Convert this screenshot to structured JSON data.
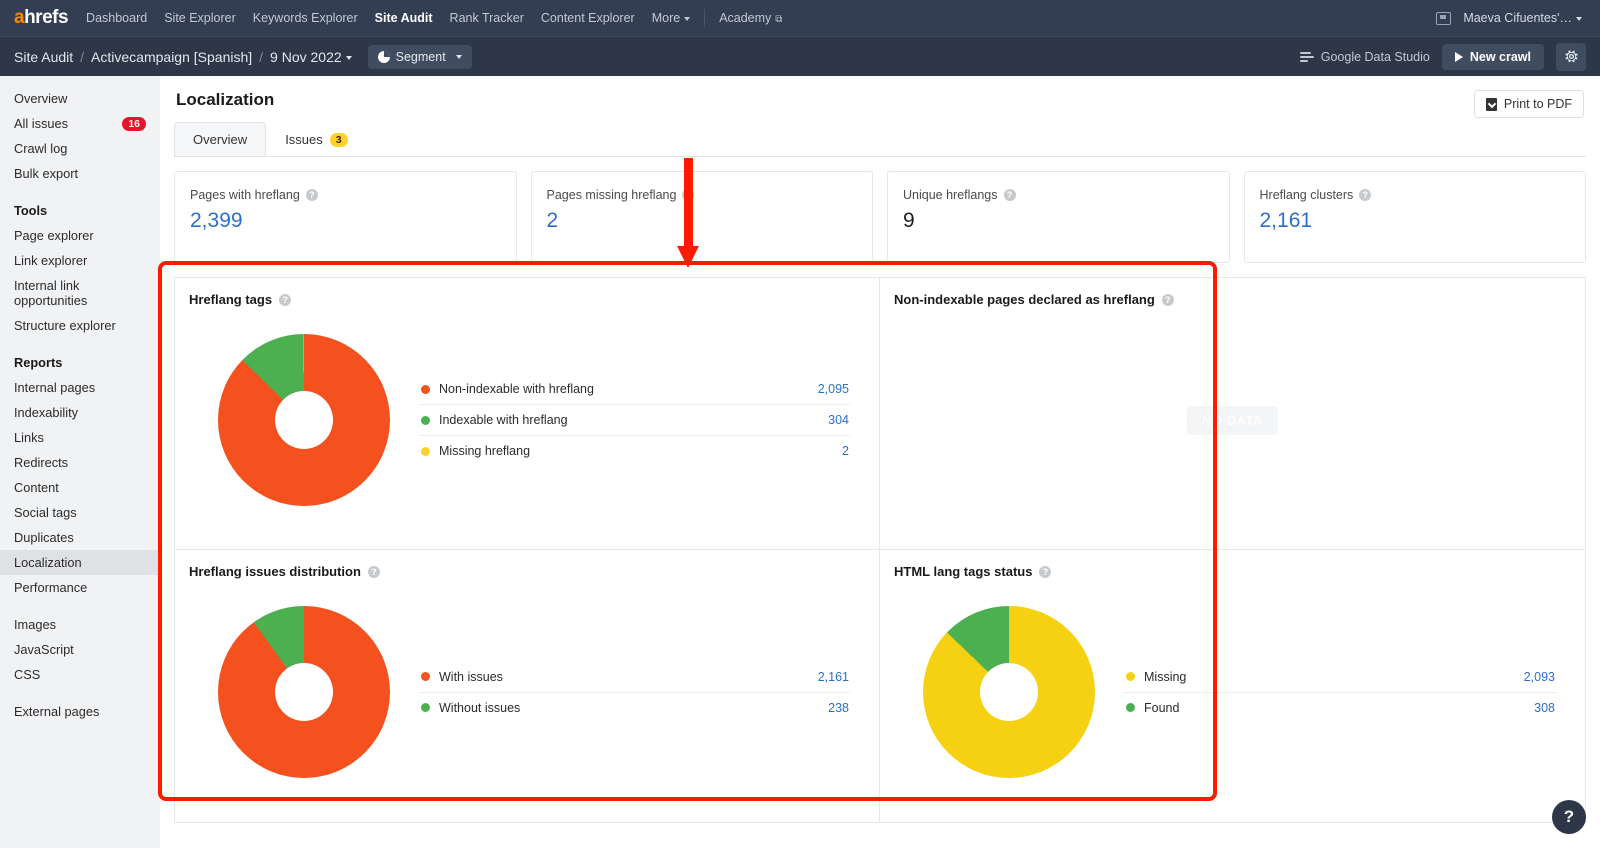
{
  "topnav": {
    "logo": "ahrefs",
    "links": [
      {
        "label": "Dashboard",
        "active": false
      },
      {
        "label": "Site Explorer",
        "active": false
      },
      {
        "label": "Keywords Explorer",
        "active": false
      },
      {
        "label": "Site Audit",
        "active": true
      },
      {
        "label": "Rank Tracker",
        "active": false
      },
      {
        "label": "Content Explorer",
        "active": false
      },
      {
        "label": "More",
        "active": false,
        "caret": true
      }
    ],
    "academy": "Academy",
    "user": "Maeva Cifuentes'…"
  },
  "breadcrumb": {
    "root": "Site Audit",
    "project": "Activecampaign [Spanish]",
    "date": "9 Nov 2022",
    "segment": "Segment",
    "google_data_studio": "Google Data Studio",
    "new_crawl": "New crawl"
  },
  "sidebar": {
    "items": [
      {
        "label": "Overview",
        "type": "item"
      },
      {
        "label": "All issues",
        "type": "item",
        "badge": "16"
      },
      {
        "label": "Crawl log",
        "type": "item"
      },
      {
        "label": "Bulk export",
        "type": "item"
      },
      {
        "label": "Tools",
        "type": "head"
      },
      {
        "label": "Page explorer",
        "type": "item"
      },
      {
        "label": "Link explorer",
        "type": "item"
      },
      {
        "label": "Internal link opportunities",
        "type": "item"
      },
      {
        "label": "Structure explorer",
        "type": "item"
      },
      {
        "label": "Reports",
        "type": "head"
      },
      {
        "label": "Internal pages",
        "type": "item"
      },
      {
        "label": "Indexability",
        "type": "item"
      },
      {
        "label": "Links",
        "type": "item"
      },
      {
        "label": "Redirects",
        "type": "item"
      },
      {
        "label": "Content",
        "type": "item"
      },
      {
        "label": "Social tags",
        "type": "item"
      },
      {
        "label": "Duplicates",
        "type": "item"
      },
      {
        "label": "Localization",
        "type": "item",
        "selected": true
      },
      {
        "label": "Performance",
        "type": "item"
      },
      {
        "label": "",
        "type": "gap"
      },
      {
        "label": "Images",
        "type": "item"
      },
      {
        "label": "JavaScript",
        "type": "item"
      },
      {
        "label": "CSS",
        "type": "item"
      },
      {
        "label": "",
        "type": "gap"
      },
      {
        "label": "External pages",
        "type": "item"
      }
    ]
  },
  "main": {
    "page_title": "Localization",
    "print_to_pdf": "Print to PDF",
    "tabs": [
      {
        "label": "Overview",
        "active": true
      },
      {
        "label": "Issues",
        "active": false,
        "badge": "3"
      }
    ],
    "cards": [
      {
        "label": "Pages with hreflang",
        "value": "2,399",
        "dark": false
      },
      {
        "label": "Pages missing hreflang",
        "value": "2",
        "dark": false
      },
      {
        "label": "Unique hreflangs",
        "value": "9",
        "dark": true
      },
      {
        "label": "Hreflang clusters",
        "value": "2,161",
        "dark": false
      }
    ],
    "help": "?"
  },
  "chart_data": [
    {
      "type": "pie",
      "title": "Hreflang tags",
      "labels": [
        "Non-indexable with hreflang",
        "Indexable with hreflang",
        "Missing hreflang"
      ],
      "values": [
        2095,
        304,
        2
      ],
      "value_labels": [
        "2,095",
        "304",
        "2"
      ],
      "colors": [
        "#f4511e",
        "#4caf50",
        "#ffd028"
      ],
      "legend": "right",
      "donut": true
    },
    {
      "type": "pie",
      "title": "Non-indexable pages declared as hreflang",
      "labels": [],
      "values": [],
      "value_labels": [],
      "colors": [],
      "empty_text": "NO DATA",
      "donut": true
    },
    {
      "type": "pie",
      "title": "Hreflang issues distribution",
      "labels": [
        "With issues",
        "Without issues"
      ],
      "values": [
        2161,
        238
      ],
      "value_labels": [
        "2,161",
        "238"
      ],
      "colors": [
        "#f4511e",
        "#4caf50"
      ],
      "legend": "right",
      "donut": true
    },
    {
      "type": "pie",
      "title": "HTML lang tags status",
      "labels": [
        "Missing",
        "Found"
      ],
      "values": [
        2093,
        308
      ],
      "value_labels": [
        "2,093",
        "308"
      ],
      "colors": [
        "#f5d112",
        "#4caf50"
      ],
      "legend": "right",
      "donut": true
    }
  ],
  "colors": {
    "accent_blue": "#2c6ecb",
    "orange": "#f4511e",
    "green": "#4caf50",
    "yellow": "#ffd028",
    "annotation_red": "#ff1a00",
    "nav_bg": "#333e52"
  }
}
